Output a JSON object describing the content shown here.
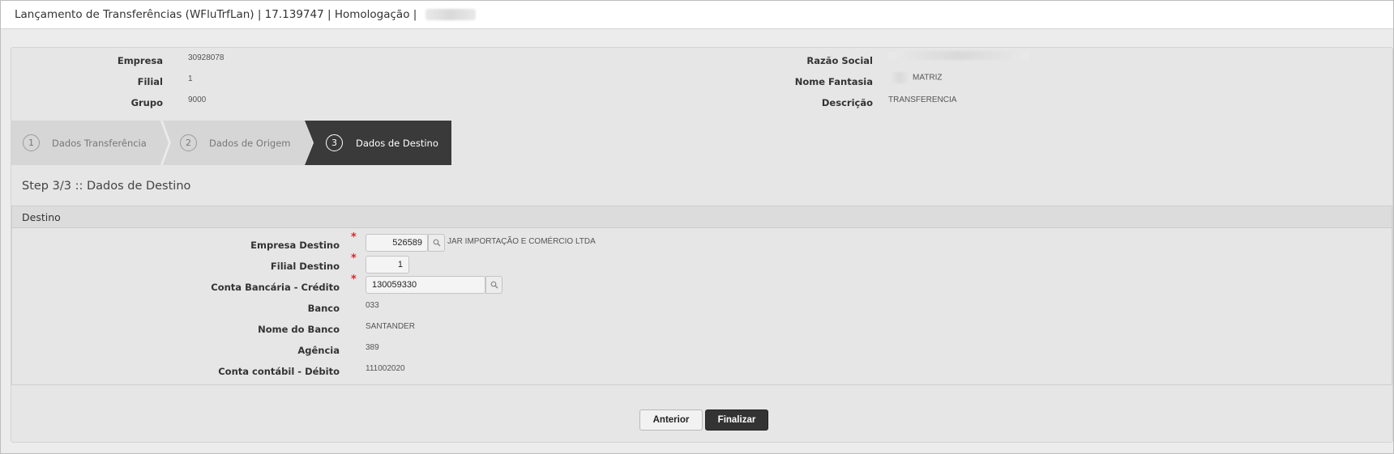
{
  "window": {
    "title": "Lançamento de Transferências (WFluTrfLan) | 17.139747 | Homologação |"
  },
  "header_info": {
    "empresa": {
      "label": "Empresa",
      "value": "30928078"
    },
    "filial": {
      "label": "Filial",
      "value": "1"
    },
    "grupo": {
      "label": "Grupo",
      "value": "9000"
    },
    "razao_social": {
      "label": "Razão Social"
    },
    "nome_fantasia": {
      "label": "Nome Fantasia",
      "value": "MATRIZ"
    },
    "descricao": {
      "label": "Descrição",
      "value": "TRANSFERENCIA"
    }
  },
  "wizard": {
    "steps": [
      {
        "number": "1",
        "label": "Dados Transferência"
      },
      {
        "number": "2",
        "label": "Dados de Origem"
      },
      {
        "number": "3",
        "label": "Dados de Destino"
      }
    ],
    "active_step": 3,
    "heading": "Step 3/3 :: Dados de Destino"
  },
  "destino": {
    "section_title": "Destino",
    "empresa_destino": {
      "label": "Empresa Destino",
      "value": "526589",
      "description": "JAR IMPORTAÇÃO E COMÉRCIO LTDA"
    },
    "filial_destino": {
      "label": "Filial Destino",
      "value": "1"
    },
    "conta_bancaria": {
      "label": "Conta Bancária - Crédito",
      "value": "130059330"
    },
    "banco": {
      "label": "Banco",
      "value": "033"
    },
    "nome_banco": {
      "label": "Nome do Banco",
      "value": "SANTANDER"
    },
    "agencia": {
      "label": "Agência",
      "value": "389"
    },
    "conta_contabil": {
      "label": "Conta contábil - Débito",
      "value": "111002020"
    },
    "required_mark": "*"
  },
  "buttons": {
    "anterior": "Anterior",
    "finalizar": "Finalizar"
  },
  "colors": {
    "active_step": "#3a3a3a",
    "inactive_step": "#d6d6d6",
    "required": "#d9262c"
  },
  "icons": {
    "lookup": "search-icon"
  }
}
